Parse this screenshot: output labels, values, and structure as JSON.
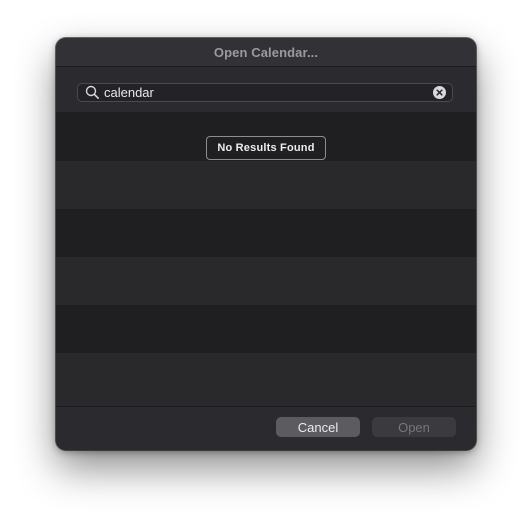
{
  "dialog": {
    "title": "Open Calendar..."
  },
  "search": {
    "value": "calendar",
    "icon": "magnifier-icon",
    "clear_icon": "clear-x-icon"
  },
  "results": {
    "empty_message": "No Results Found"
  },
  "footer": {
    "cancel_label": "Cancel",
    "open_label": "Open",
    "open_enabled": false
  }
}
